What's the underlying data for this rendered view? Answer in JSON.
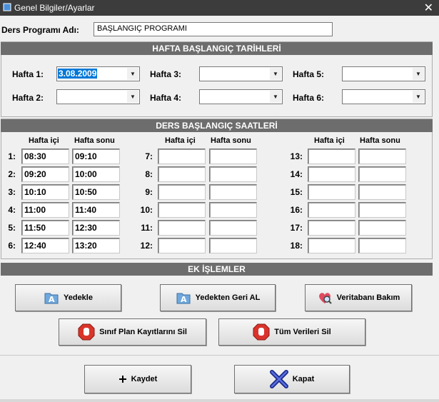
{
  "window": {
    "title": "Genel Bilgiler/Ayarlar",
    "close_glyph": "✕"
  },
  "program": {
    "label": "Ders Programı Adı:",
    "value": "BAŞLANGIÇ PROGRAMI"
  },
  "week_dates": {
    "header": "HAFTA BAŞLANGIÇ TARİHLERİ",
    "weeks": [
      {
        "label": "Hafta 1:",
        "value": "3.08.2009"
      },
      {
        "label": "Hafta 2:",
        "value": ""
      },
      {
        "label": "Hafta 3:",
        "value": ""
      },
      {
        "label": "Hafta 4:",
        "value": ""
      },
      {
        "label": "Hafta 5:",
        "value": ""
      },
      {
        "label": "Hafta 6:",
        "value": ""
      }
    ]
  },
  "lesson_times": {
    "header": "DERS BAŞLANGIÇ SAATLERİ",
    "col_weekday": "Hafta içi",
    "col_weekend": "Hafta sonu",
    "rows": [
      {
        "label": "1:",
        "weekday": "08:30",
        "weekend": "09:10"
      },
      {
        "label": "2:",
        "weekday": "09:20",
        "weekend": "10:00"
      },
      {
        "label": "3:",
        "weekday": "10:10",
        "weekend": "10:50"
      },
      {
        "label": "4:",
        "weekday": "11:00",
        "weekend": "11:40"
      },
      {
        "label": "5:",
        "weekday": "11:50",
        "weekend": "12:30"
      },
      {
        "label": "6:",
        "weekday": "12:40",
        "weekend": "13:20"
      },
      {
        "label": "7:",
        "weekday": "",
        "weekend": ""
      },
      {
        "label": "8:",
        "weekday": "",
        "weekend": ""
      },
      {
        "label": "9:",
        "weekday": "",
        "weekend": ""
      },
      {
        "label": "10:",
        "weekday": "",
        "weekend": ""
      },
      {
        "label": "11:",
        "weekday": "",
        "weekend": ""
      },
      {
        "label": "12:",
        "weekday": "",
        "weekend": ""
      },
      {
        "label": "13:",
        "weekday": "",
        "weekend": ""
      },
      {
        "label": "14:",
        "weekday": "",
        "weekend": ""
      },
      {
        "label": "15:",
        "weekday": "",
        "weekend": ""
      },
      {
        "label": "16:",
        "weekday": "",
        "weekend": ""
      },
      {
        "label": "17:",
        "weekday": "",
        "weekend": ""
      },
      {
        "label": "18:",
        "weekday": "",
        "weekend": ""
      }
    ]
  },
  "extra_ops": {
    "header": "EK İŞLEMLER",
    "backup": "Yedekle",
    "restore": "Yedekten Geri AL",
    "db_maintenance": "Veritabanı Bakım",
    "delete_class_plans": "Sınıf Plan Kayıtlarını Sil",
    "delete_all": "Tüm Verileri Sil"
  },
  "footer": {
    "save": "Kaydet",
    "close": "Kapat"
  },
  "colors": {
    "section_header": "#6d6d6d",
    "selection": "#0078d7",
    "stop_red": "#d9342b",
    "titlebar": "#3c3c3c"
  },
  "icons": {
    "backup": "folder-a-icon",
    "restore": "folder-a-icon",
    "db": "heart-magnifier-icon",
    "delete": "stop-hand-icon",
    "save": "plus-icon",
    "close": "x-mark-icon"
  }
}
